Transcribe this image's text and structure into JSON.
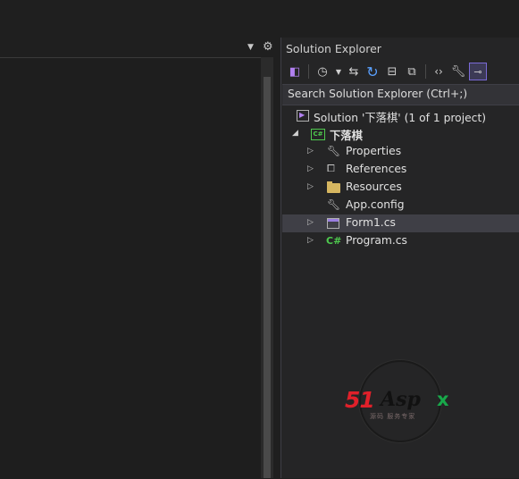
{
  "solution_explorer": {
    "title": "Solution Explorer",
    "search_placeholder": "Search Solution Explorer (Ctrl+;)",
    "toolbar": [
      {
        "name": "vs-logo-icon",
        "glyph": "◧"
      },
      {
        "name": "history-icon",
        "glyph": "🕓︎"
      },
      {
        "name": "sync-icon",
        "glyph": "⇆"
      },
      {
        "name": "refresh-icon",
        "glyph": "↻"
      },
      {
        "name": "collapse-all-icon",
        "glyph": "⊟"
      },
      {
        "name": "show-all-files-icon",
        "glyph": "⧉"
      },
      {
        "name": "view-code-icon",
        "glyph": "‹›"
      },
      {
        "name": "properties-icon",
        "glyph": "🔧︎"
      },
      {
        "name": "preview-icon",
        "glyph": "⊸"
      }
    ],
    "tree": {
      "solution": "Solution '下落棋' (1 of 1 project)",
      "project": "下落棋",
      "items": [
        {
          "label": "Properties",
          "icon": "wrench-icon"
        },
        {
          "label": "References",
          "icon": "references-icon"
        },
        {
          "label": "Resources",
          "icon": "folder-icon"
        },
        {
          "label": "App.config",
          "icon": "config-icon"
        },
        {
          "label": "Form1.cs",
          "icon": "form-icon"
        },
        {
          "label": "Program.cs",
          "icon": "csharp-icon"
        }
      ]
    }
  },
  "watermark": {
    "logo_text_number": "51",
    "logo_text_name": "Asp",
    "logo_text_x": "x",
    "subtitle": "源码 服务专家"
  }
}
